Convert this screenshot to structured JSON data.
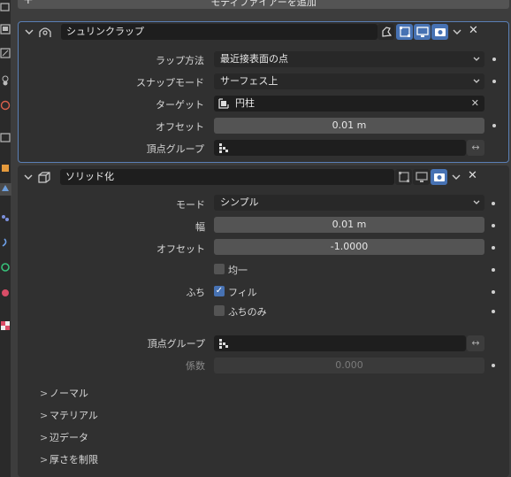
{
  "add_modifier": {
    "plus": "+",
    "label": "モディファイアーを追加"
  },
  "shrinkwrap": {
    "name": "シュリンクラップ",
    "props": {
      "wrap_method_label": "ラップ方法",
      "wrap_method_value": "最近接表面の点",
      "snap_mode_label": "スナップモード",
      "snap_mode_value": "サーフェス上",
      "target_label": "ターゲット",
      "target_value": "円柱",
      "offset_label": "オフセット",
      "offset_value": "0.01 m",
      "vgroup_label": "頂点グループ",
      "vgroup_value": ""
    }
  },
  "solidify": {
    "name": "ソリッド化",
    "props": {
      "mode_label": "モード",
      "mode_value": "シンプル",
      "thickness_label": "幅",
      "thickness_value": "0.01 m",
      "offset_label": "オフセット",
      "offset_value": "-1.0000",
      "even_label": "均一",
      "rim_label": "ふち",
      "fill_label": "フィル",
      "rim_only_label": "ふちのみ",
      "vgroup_label": "頂点グループ",
      "factor_label": "係数",
      "factor_value": "0.000"
    },
    "subpanels": [
      "ノーマル",
      "マテリアル",
      "辺データ",
      "厚さを制限"
    ]
  },
  "icons": {
    "caret": ">",
    "close": "✕",
    "swap": "↔",
    "check": "✓"
  },
  "colors": {
    "accent": "#4772b3",
    "active_outline": "#5a7fb5",
    "panel_bg": "#303030",
    "window_bg": "#3d3d3d"
  }
}
